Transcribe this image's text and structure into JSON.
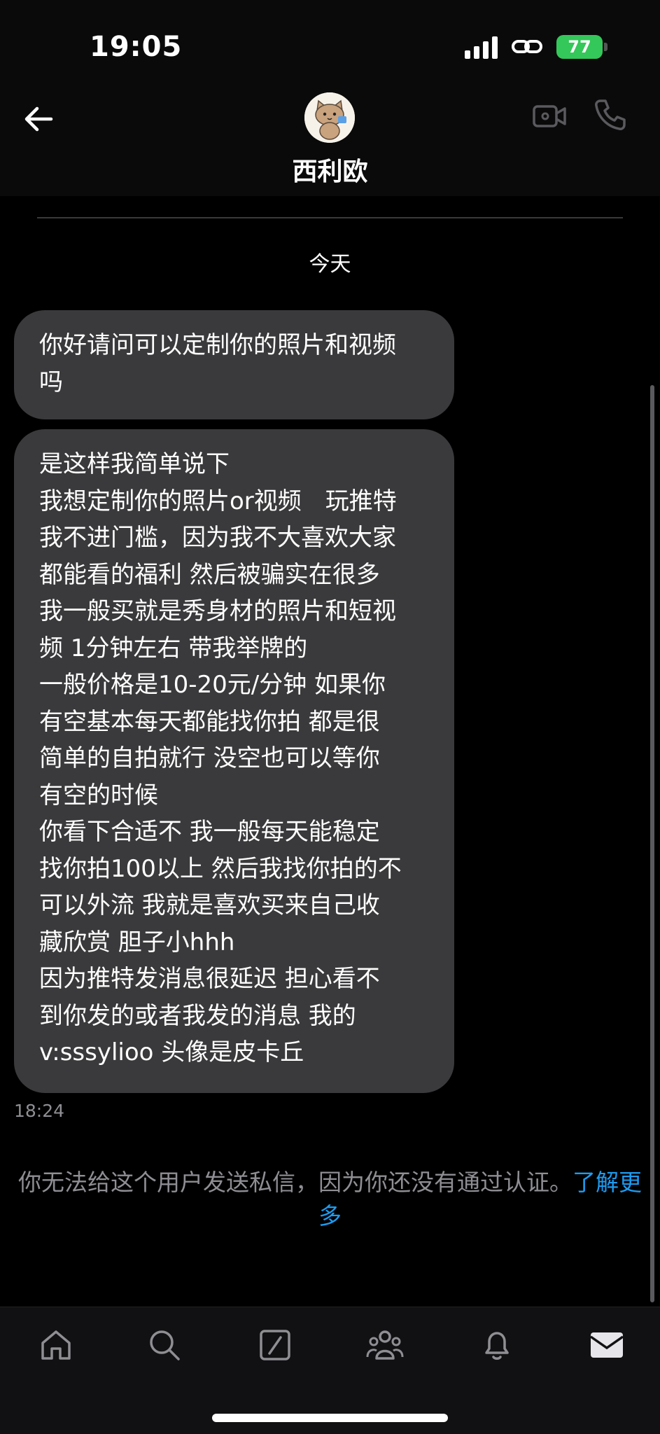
{
  "status_bar": {
    "time": "19:05",
    "battery": "77"
  },
  "header": {
    "contact_name": "西利欧"
  },
  "conversation": {
    "date_separator": "今天",
    "messages": [
      {
        "text": "你好请问可以定制你的照片和视频\n吗"
      },
      {
        "text": "是这样我简单说下\n我想定制你的照片or视频　玩推特\n我不进门槛，因为我不大喜欢大家\n都能看的福利  然后被骗实在很多\n我一般买就是秀身材的照片和短视\n频 1分钟左右 带我举牌的\n一般价格是10-20元/分钟  如果你\n有空基本每天都能找你拍 都是很\n简单的自拍就行 没空也可以等你\n有空的时候\n你看下合适不  我一般每天能稳定\n找你拍100以上 然后我找你拍的不\n可以外流 我就是喜欢买来自己收\n藏欣赏 胆子小hhh\n因为推特发消息很延迟 担心看不\n到你发的或者我发的消息  我的\nv:sssylioo 头像是皮卡丘"
      }
    ],
    "last_timestamp": "18:24"
  },
  "notice": {
    "text": "你无法给这个用户发送私信，因为你还没有通过认证。",
    "link_text": "了解更多"
  },
  "tabs": [
    {
      "icon": "home-icon"
    },
    {
      "icon": "search-icon"
    },
    {
      "icon": "grok-icon"
    },
    {
      "icon": "communities-icon"
    },
    {
      "icon": "notifications-icon"
    },
    {
      "icon": "messages-icon"
    }
  ],
  "colors": {
    "bubble": "#3a3a3c",
    "link": "#1d9bf0",
    "battery": "#34c759",
    "muted": "#8e8e93"
  }
}
